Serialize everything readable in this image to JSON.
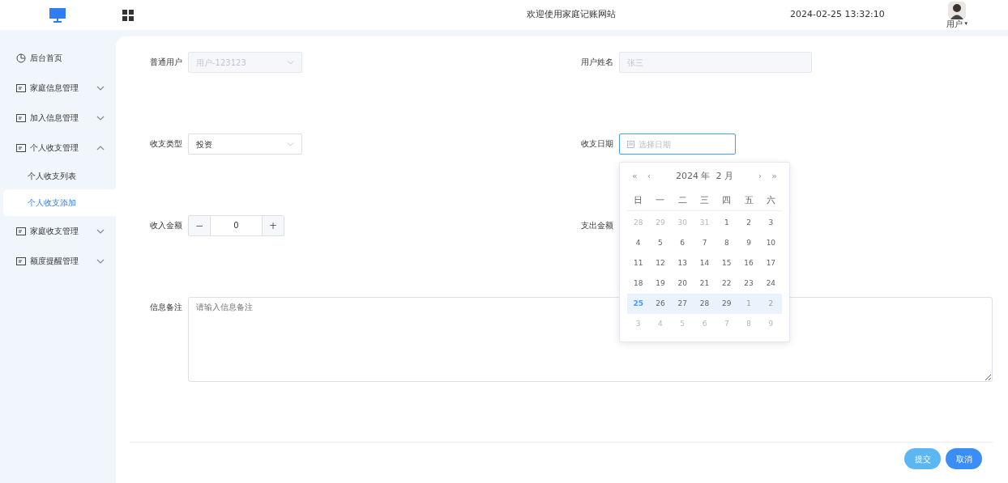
{
  "header": {
    "title": "欢迎使用家庭记账网站",
    "datetime": "2024-02-25 13:32:10",
    "user": {
      "label": "用户",
      "caret": "▾"
    }
  },
  "sidebar": {
    "items": [
      {
        "label": "后台首页",
        "kind": "link"
      },
      {
        "label": "家庭信息管理",
        "kind": "group",
        "expanded": false
      },
      {
        "label": "加入信息管理",
        "kind": "group",
        "expanded": false
      },
      {
        "label": "个人收支管理",
        "kind": "group",
        "expanded": true,
        "children": [
          {
            "label": "个人收支列表",
            "selected": false
          },
          {
            "label": "个人收支添加",
            "selected": true
          }
        ]
      },
      {
        "label": "家庭收支管理",
        "kind": "group",
        "expanded": false
      },
      {
        "label": "额度提醒管理",
        "kind": "group",
        "expanded": false
      }
    ]
  },
  "form": {
    "fields": [
      {
        "label": "普通用户",
        "kind": "select",
        "value": "用户-123123",
        "disabled": true
      },
      {
        "label": "用户姓名",
        "kind": "text",
        "value": "张三",
        "disabled": true
      },
      {
        "label": "收支类型",
        "kind": "select",
        "value": "投资"
      },
      {
        "label": "收支日期",
        "kind": "date",
        "placeholder": "选择日期"
      },
      {
        "label": "收入金额",
        "kind": "number",
        "value": "0",
        "minus": "−",
        "plus": "+"
      },
      {
        "label": "支出金额",
        "kind": "hidden"
      },
      {
        "label": "信息备注",
        "kind": "textarea",
        "placeholder": "请输入信息备注"
      }
    ],
    "buttons": [
      {
        "label": "提交",
        "kind": "secondary"
      },
      {
        "label": "取消",
        "kind": "primary"
      }
    ]
  },
  "datepicker": {
    "prev_year": "«",
    "prev_month": "‹",
    "title": "2024 年  2 月",
    "next_month": "›",
    "next_year": "»",
    "weekdays": [
      "日",
      "一",
      "二",
      "三",
      "四",
      "五",
      "六"
    ],
    "weeks": [
      {
        "highlighted": false,
        "days": [
          {
            "text": "28",
            "kind": "other"
          },
          {
            "text": "29",
            "kind": "other"
          },
          {
            "text": "30",
            "kind": "other"
          },
          {
            "text": "31",
            "kind": "other"
          },
          {
            "text": "1",
            "kind": "current"
          },
          {
            "text": "2",
            "kind": "current"
          },
          {
            "text": "3",
            "kind": "current"
          }
        ]
      },
      {
        "highlighted": false,
        "days": [
          {
            "text": "4",
            "kind": "current"
          },
          {
            "text": "5",
            "kind": "current"
          },
          {
            "text": "6",
            "kind": "current"
          },
          {
            "text": "7",
            "kind": "current"
          },
          {
            "text": "8",
            "kind": "current"
          },
          {
            "text": "9",
            "kind": "current"
          },
          {
            "text": "10",
            "kind": "current"
          }
        ]
      },
      {
        "highlighted": false,
        "days": [
          {
            "text": "11",
            "kind": "current"
          },
          {
            "text": "12",
            "kind": "current"
          },
          {
            "text": "13",
            "kind": "current"
          },
          {
            "text": "14",
            "kind": "current"
          },
          {
            "text": "15",
            "kind": "current"
          },
          {
            "text": "16",
            "kind": "current"
          },
          {
            "text": "17",
            "kind": "current"
          }
        ]
      },
      {
        "highlighted": false,
        "days": [
          {
            "text": "18",
            "kind": "current"
          },
          {
            "text": "19",
            "kind": "current"
          },
          {
            "text": "20",
            "kind": "current"
          },
          {
            "text": "21",
            "kind": "current"
          },
          {
            "text": "22",
            "kind": "current"
          },
          {
            "text": "23",
            "kind": "current"
          },
          {
            "text": "24",
            "kind": "current"
          }
        ]
      },
      {
        "highlighted": true,
        "days": [
          {
            "text": "25",
            "kind": "today"
          },
          {
            "text": "26",
            "kind": "current"
          },
          {
            "text": "27",
            "kind": "current"
          },
          {
            "text": "28",
            "kind": "current"
          },
          {
            "text": "29",
            "kind": "current"
          },
          {
            "text": "1",
            "kind": "other"
          },
          {
            "text": "2",
            "kind": "other"
          }
        ]
      },
      {
        "highlighted": false,
        "days": [
          {
            "text": "3",
            "kind": "other"
          },
          {
            "text": "4",
            "kind": "other"
          },
          {
            "text": "5",
            "kind": "other"
          },
          {
            "text": "6",
            "kind": "other"
          },
          {
            "text": "7",
            "kind": "other"
          },
          {
            "text": "8",
            "kind": "other"
          },
          {
            "text": "9",
            "kind": "other"
          }
        ]
      }
    ]
  }
}
